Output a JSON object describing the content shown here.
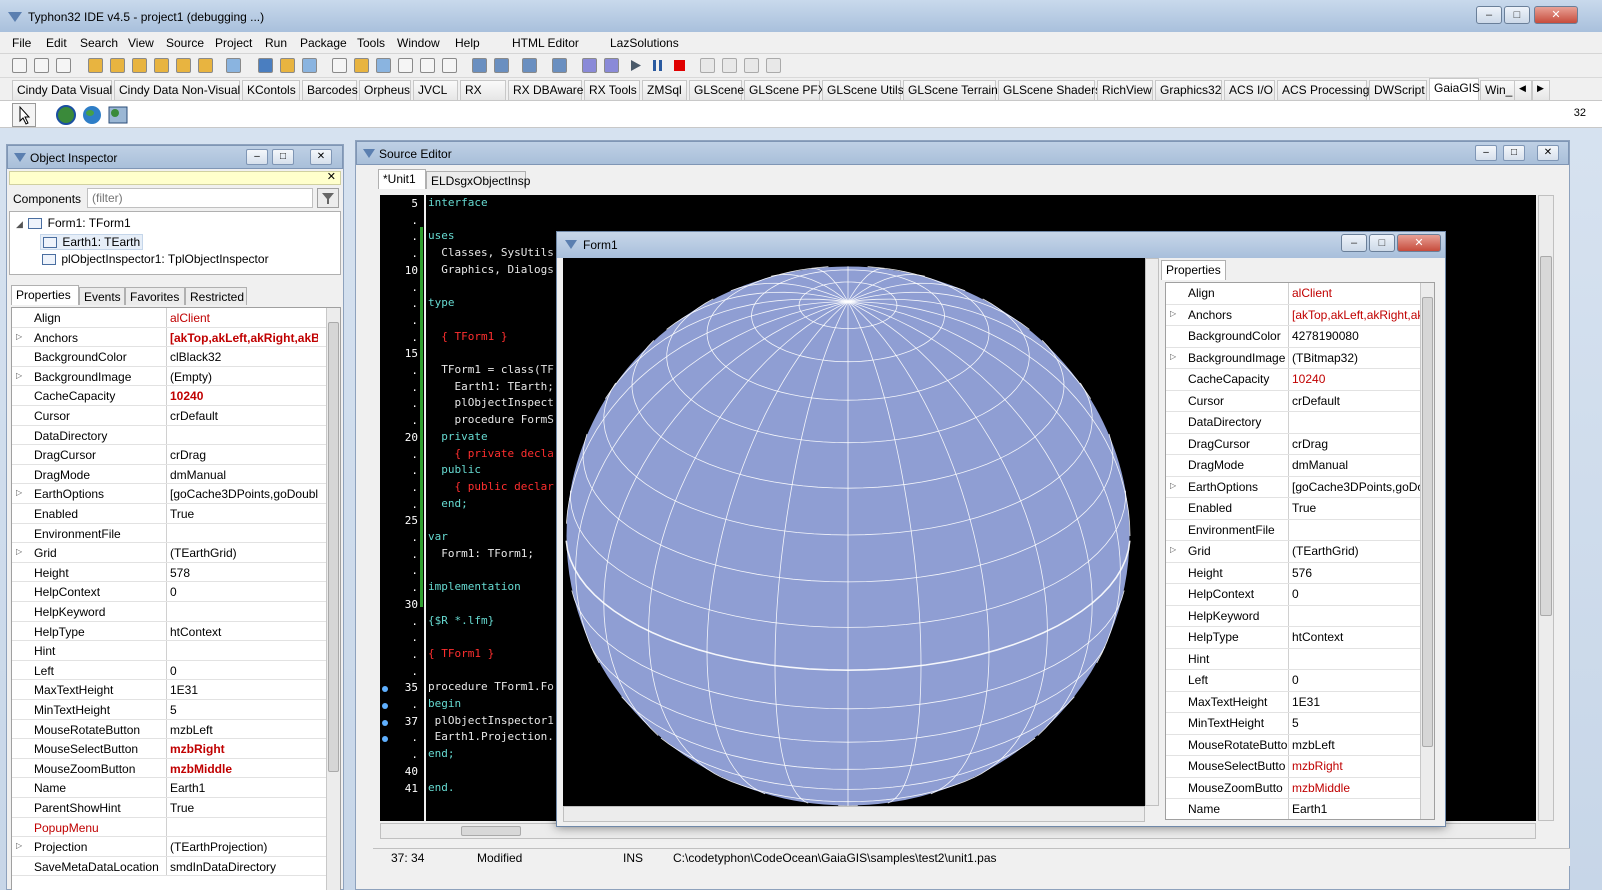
{
  "ide": {
    "title": "Typhon32 IDE v4.5 - project1 (debugging ...)",
    "menu": [
      "File",
      "Edit",
      "Search",
      "View",
      "Source",
      "Project",
      "Run",
      "Package",
      "Tools",
      "Window",
      "Help",
      "HTML Editor",
      "LazSolutions"
    ],
    "palette_tabs": [
      "Cindy Data Visual",
      "Cindy Data Non-Visual",
      "KContols",
      "Barcodes",
      "Orpheus",
      "JVCL",
      "RX",
      "RX DBAware",
      "RX Tools",
      "ZMSql",
      "GLScene",
      "GLScene PFX",
      "GLScene Utils",
      "GLScene Terrain",
      "GLScene Shaders",
      "RichView",
      "Graphics32",
      "ACS I/O",
      "ACS Processing",
      "DWScript",
      "GaiaGIS",
      "Win_"
    ],
    "active_palette_tab": "GaiaGIS",
    "side_label": "32"
  },
  "object_inspector": {
    "title": "Object Inspector",
    "components_label": "Components",
    "filter_placeholder": "(filter)",
    "tree": [
      {
        "label": "Form1: TForm1"
      },
      {
        "label": "Earth1: TEarth"
      },
      {
        "label": "plObjectInspector1: TplObjectInspector"
      }
    ],
    "tabs": [
      "Properties",
      "Events",
      "Favorites",
      "Restricted"
    ],
    "properties": [
      {
        "name": "Align",
        "value": "alClient",
        "red": true,
        "bold": false
      },
      {
        "name": "Anchors",
        "value": "[akTop,akLeft,akRight,akBo",
        "red": true,
        "bold": true,
        "expandable": true
      },
      {
        "name": "BackgroundColor",
        "value": "clBlack32"
      },
      {
        "name": "BackgroundImage",
        "value": "(Empty)",
        "expandable": true
      },
      {
        "name": "CacheCapacity",
        "value": "10240",
        "red": true,
        "bold": true
      },
      {
        "name": "Cursor",
        "value": "crDefault"
      },
      {
        "name": "DataDirectory",
        "value": ""
      },
      {
        "name": "DragCursor",
        "value": "crDrag"
      },
      {
        "name": "DragMode",
        "value": "dmManual"
      },
      {
        "name": "EarthOptions",
        "value": "[goCache3DPoints,goDouble",
        "expandable": true
      },
      {
        "name": "Enabled",
        "value": "True"
      },
      {
        "name": "EnvironmentFile",
        "value": ""
      },
      {
        "name": "Grid",
        "value": "(TEarthGrid)",
        "expandable": true
      },
      {
        "name": "Height",
        "value": "578"
      },
      {
        "name": "HelpContext",
        "value": "0"
      },
      {
        "name": "HelpKeyword",
        "value": ""
      },
      {
        "name": "HelpType",
        "value": "htContext"
      },
      {
        "name": "Hint",
        "value": ""
      },
      {
        "name": "Left",
        "value": "0"
      },
      {
        "name": "MaxTextHeight",
        "value": "1E31"
      },
      {
        "name": "MinTextHeight",
        "value": "5"
      },
      {
        "name": "MouseRotateButton",
        "value": "mzbLeft"
      },
      {
        "name": "MouseSelectButton",
        "value": "mzbRight",
        "red": true,
        "bold": true
      },
      {
        "name": "MouseZoomButton",
        "value": "mzbMiddle",
        "red": true,
        "bold": true
      },
      {
        "name": "Name",
        "value": "Earth1"
      },
      {
        "name": "ParentShowHint",
        "value": "True"
      },
      {
        "name": "PopupMenu",
        "value": "",
        "red_name": true
      },
      {
        "name": "Projection",
        "value": "(TEarthProjection)",
        "expandable": true
      },
      {
        "name": "SaveMetaDataLocation",
        "value": "smdInDataDirectory"
      }
    ]
  },
  "source_editor": {
    "title": "Source Editor",
    "tabs": [
      "*Unit1",
      "ELDsgxObjectInsp"
    ],
    "gutter": [
      {
        "n": "5",
        "dot": false
      },
      {
        "n": ".",
        "dot": false
      },
      {
        "n": ".",
        "dot": false
      },
      {
        "n": ".",
        "dot": false
      },
      {
        "n": "10",
        "dot": false
      },
      {
        "n": ".",
        "dot": false
      },
      {
        "n": ".",
        "dot": false
      },
      {
        "n": ".",
        "dot": false
      },
      {
        "n": ".",
        "dot": false
      },
      {
        "n": "15",
        "dot": false
      },
      {
        "n": ".",
        "dot": false
      },
      {
        "n": ".",
        "dot": false
      },
      {
        "n": ".",
        "dot": false
      },
      {
        "n": ".",
        "dot": false
      },
      {
        "n": "20",
        "dot": false
      },
      {
        "n": ".",
        "dot": false
      },
      {
        "n": ".",
        "dot": false
      },
      {
        "n": ".",
        "dot": false
      },
      {
        "n": ".",
        "dot": false
      },
      {
        "n": "25",
        "dot": false
      },
      {
        "n": ".",
        "dot": false
      },
      {
        "n": ".",
        "dot": false
      },
      {
        "n": ".",
        "dot": false
      },
      {
        "n": ".",
        "dot": false
      },
      {
        "n": "30",
        "dot": false
      },
      {
        "n": ".",
        "dot": false
      },
      {
        "n": ".",
        "dot": false
      },
      {
        "n": ".",
        "dot": false
      },
      {
        "n": ".",
        "dot": false
      },
      {
        "n": "35",
        "dot": true
      },
      {
        "n": ".",
        "dot": true
      },
      {
        "n": "37",
        "dot": true
      },
      {
        "n": ".",
        "dot": true
      },
      {
        "n": ".",
        "dot": false
      },
      {
        "n": "40",
        "dot": false
      },
      {
        "n": "41",
        "dot": false
      }
    ],
    "lines": [
      {
        "t": "interface",
        "c": "kw"
      },
      {
        "t": "",
        "c": "nm"
      },
      {
        "t": "uses",
        "c": "kw"
      },
      {
        "t": "  Classes, SysUtils",
        "c": "nm"
      },
      {
        "t": "  Graphics, Dialogs",
        "c": "nm"
      },
      {
        "t": "",
        "c": "nm"
      },
      {
        "t": "type",
        "c": "kw"
      },
      {
        "t": "",
        "c": "nm"
      },
      {
        "t": "  { TForm1 }",
        "c": "cm"
      },
      {
        "t": "",
        "c": "nm"
      },
      {
        "t": "  TForm1 = class(TF",
        "c": "nm"
      },
      {
        "t": "    Earth1: TEarth;",
        "c": "nm"
      },
      {
        "t": "    plObjectInspect",
        "c": "nm"
      },
      {
        "t": "    procedure FormS",
        "c": "nm"
      },
      {
        "t": "  private",
        "c": "kw"
      },
      {
        "t": "    { private decla",
        "c": "cm"
      },
      {
        "t": "  public",
        "c": "kw"
      },
      {
        "t": "    { public declar",
        "c": "cm"
      },
      {
        "t": "  end;",
        "c": "kw"
      },
      {
        "t": "",
        "c": "nm"
      },
      {
        "t": "var",
        "c": "kw"
      },
      {
        "t": "  Form1: TForm1;",
        "c": "nm"
      },
      {
        "t": "",
        "c": "nm"
      },
      {
        "t": "implementation",
        "c": "kw"
      },
      {
        "t": "",
        "c": "nm"
      },
      {
        "t": "{$R *.lfm}",
        "c": "kw"
      },
      {
        "t": "",
        "c": "nm"
      },
      {
        "t": "{ TForm1 }",
        "c": "cm"
      },
      {
        "t": "",
        "c": "nm"
      },
      {
        "t": "procedure TForm1.Fo",
        "c": "nm"
      },
      {
        "t": "begin",
        "c": "kw"
      },
      {
        "t": " plObjectInspector1",
        "c": "nm"
      },
      {
        "t": " Earth1.Projection.",
        "c": "nm"
      },
      {
        "t": "end;",
        "c": "kw"
      },
      {
        "t": "",
        "c": "nm"
      },
      {
        "t": "end.",
        "c": "kw"
      },
      {
        "t": "",
        "c": "nm"
      }
    ]
  },
  "form1": {
    "title": "Form1",
    "properties_tab": "Properties",
    "properties": [
      {
        "name": "Align",
        "value": "alClient",
        "red": true
      },
      {
        "name": "Anchors",
        "value": "[akTop,akLeft,akRight,ak",
        "red": true,
        "expandable": true
      },
      {
        "name": "BackgroundColor",
        "value": "4278190080"
      },
      {
        "name": "BackgroundImage",
        "value": "(TBitmap32)",
        "expandable": true
      },
      {
        "name": "CacheCapacity",
        "value": "10240",
        "red": true
      },
      {
        "name": "Cursor",
        "value": "crDefault"
      },
      {
        "name": "DataDirectory",
        "value": ""
      },
      {
        "name": "DragCursor",
        "value": "crDrag"
      },
      {
        "name": "DragMode",
        "value": "dmManual"
      },
      {
        "name": "EarthOptions",
        "value": "[goCache3DPoints,goDo",
        "expandable": true
      },
      {
        "name": "Enabled",
        "value": "True"
      },
      {
        "name": "EnvironmentFile",
        "value": ""
      },
      {
        "name": "Grid",
        "value": "(TEarthGrid)",
        "expandable": true
      },
      {
        "name": "Height",
        "value": "576"
      },
      {
        "name": "HelpContext",
        "value": "0"
      },
      {
        "name": "HelpKeyword",
        "value": ""
      },
      {
        "name": "HelpType",
        "value": "htContext"
      },
      {
        "name": "Hint",
        "value": ""
      },
      {
        "name": "Left",
        "value": "0"
      },
      {
        "name": "MaxTextHeight",
        "value": "1E31"
      },
      {
        "name": "MinTextHeight",
        "value": "5"
      },
      {
        "name": "MouseRotateButto",
        "value": "mzbLeft"
      },
      {
        "name": "MouseSelectButto",
        "value": "mzbRight",
        "red": true
      },
      {
        "name": "MouseZoomButto",
        "value": "mzbMiddle",
        "red": true
      },
      {
        "name": "Name",
        "value": "Earth1"
      }
    ]
  },
  "status_bar": {
    "position": "37: 34",
    "state": "Modified",
    "mode": "INS",
    "path": "C:\\codetyphon\\CodeOcean\\GaiaGIS\\samples\\test2\\unit1.pas"
  },
  "colors": {
    "globe_fill": "#8f9ed3",
    "globe_grid": "#ffffff",
    "editor_bg": "#000000",
    "keyword": "#66d9d0",
    "comment": "#ff2f2f",
    "highlight": "#c00000",
    "inspector_filter_bar": "#ffffcc"
  },
  "icons": [
    "app-icon",
    "pointer-icon",
    "globe-component-icon",
    "earth-component-icon",
    "inspector-component-icon",
    "run-icon",
    "pause-icon",
    "stop-icon",
    "filter-icon"
  ]
}
